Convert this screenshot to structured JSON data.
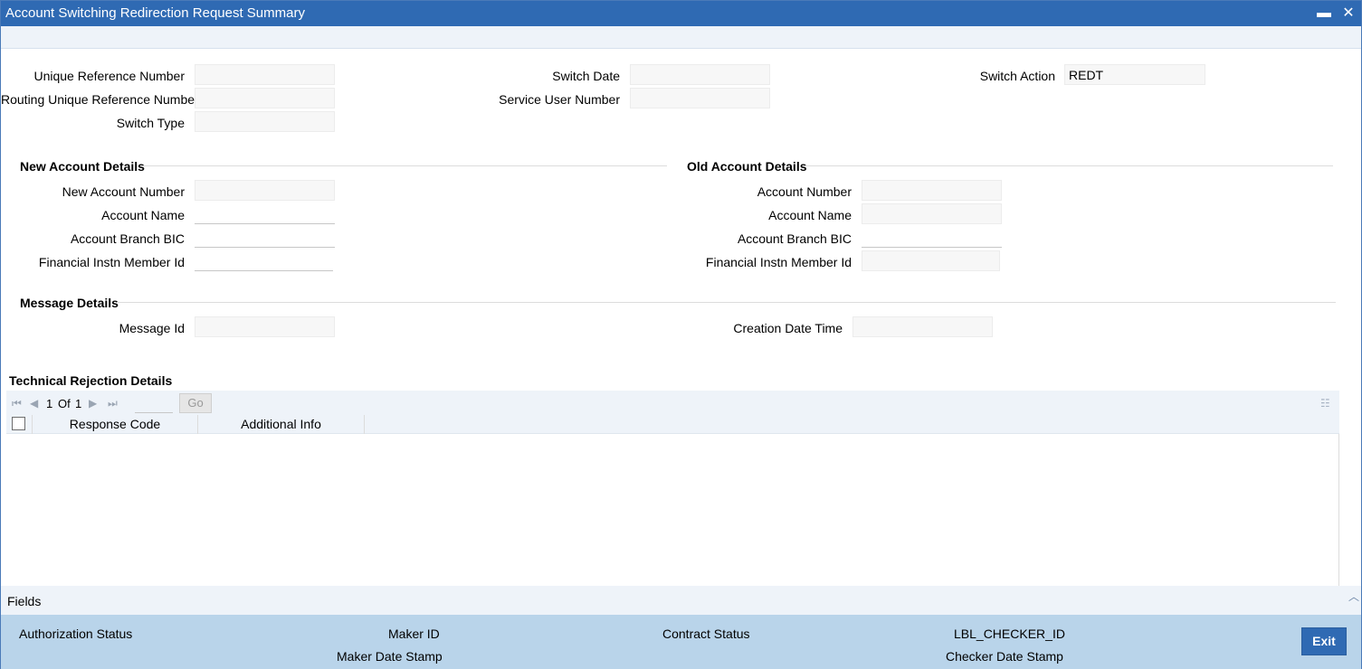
{
  "window": {
    "title": "Account Switching Redirection Request Summary",
    "minimize_glyph": "▬",
    "close_glyph": "✕"
  },
  "header_fields": {
    "unique_reference_number": {
      "label": "Unique Reference Number",
      "value": ""
    },
    "routing_unique_reference_number": {
      "label": "Routing Unique Reference Number",
      "value": ""
    },
    "switch_type": {
      "label": "Switch Type",
      "value": ""
    },
    "switch_date": {
      "label": "Switch Date",
      "value": ""
    },
    "service_user_number": {
      "label": "Service User Number",
      "value": ""
    },
    "switch_action": {
      "label": "Switch Action",
      "value": "REDT"
    }
  },
  "new_account": {
    "title": "New Account Details",
    "account_number": {
      "label": "New Account Number",
      "value": ""
    },
    "account_name": {
      "label": "Account Name",
      "value": ""
    },
    "branch_bic": {
      "label": "Account Branch BIC",
      "value": ""
    },
    "member_id": {
      "label": "Financial Instn Member Id",
      "value": ""
    }
  },
  "old_account": {
    "title": "Old Account Details",
    "account_number": {
      "label": "Account Number",
      "value": ""
    },
    "account_name": {
      "label": "Account Name",
      "value": ""
    },
    "branch_bic": {
      "label": "Account Branch BIC",
      "value": ""
    },
    "member_id": {
      "label": "Financial Instn Member Id",
      "value": ""
    }
  },
  "message": {
    "title": "Message Details",
    "message_id": {
      "label": "Message Id",
      "value": ""
    },
    "creation_date_time": {
      "label": "Creation Date Time",
      "value": ""
    }
  },
  "rejection": {
    "title": "Technical Rejection Details",
    "pager": {
      "page": "1",
      "of_label": "Of",
      "total": "1",
      "go_label": "Go"
    },
    "columns": [
      "Response Code",
      "Additional Info"
    ],
    "rows": []
  },
  "fields_bar": {
    "label": "Fields"
  },
  "footer": {
    "authorization_status": "Authorization Status",
    "maker_id": "Maker ID",
    "maker_date_stamp": "Maker Date Stamp",
    "contract_status": "Contract Status",
    "checker_id": "LBL_CHECKER_ID",
    "checker_date_stamp": "Checker Date Stamp",
    "exit_label": "Exit"
  },
  "colors": {
    "titlebar": "#2f6ab3",
    "footer": "#b9d4ea",
    "strip": "#eef3f9"
  }
}
